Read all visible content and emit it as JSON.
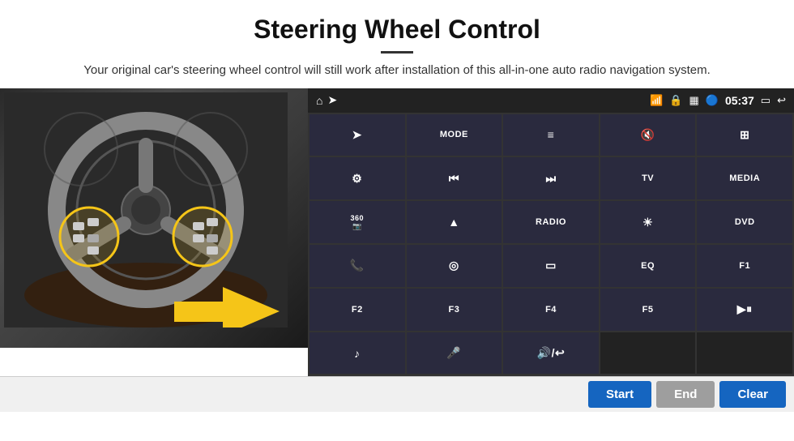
{
  "header": {
    "title": "Steering Wheel Control",
    "subtitle": "Your original car's steering wheel control will still work after installation of this all-in-one auto radio navigation system."
  },
  "status_bar": {
    "home_icon": "⌂",
    "wifi_icon": "📶",
    "lock_icon": "🔒",
    "bt_icon": "🔵",
    "time": "05:37",
    "screen_icon": "▭",
    "back_icon": "↩"
  },
  "button_grid": [
    {
      "label": "✈",
      "type": "icon"
    },
    {
      "label": "MODE",
      "type": "text"
    },
    {
      "label": "≡",
      "type": "icon"
    },
    {
      "label": "🔇",
      "type": "icon"
    },
    {
      "label": "⊞",
      "type": "icon"
    },
    {
      "label": "⚙",
      "type": "icon"
    },
    {
      "label": "⏮",
      "type": "icon"
    },
    {
      "label": "⏭",
      "type": "icon"
    },
    {
      "label": "TV",
      "type": "text"
    },
    {
      "label": "MEDIA",
      "type": "text"
    },
    {
      "label": "360",
      "type": "text"
    },
    {
      "label": "▲",
      "type": "icon"
    },
    {
      "label": "RADIO",
      "type": "text"
    },
    {
      "label": "☀",
      "type": "icon"
    },
    {
      "label": "DVD",
      "type": "text"
    },
    {
      "label": "📞",
      "type": "icon"
    },
    {
      "label": "◎",
      "type": "icon"
    },
    {
      "label": "▭",
      "type": "icon"
    },
    {
      "label": "EQ",
      "type": "text"
    },
    {
      "label": "F1",
      "type": "text"
    },
    {
      "label": "F2",
      "type": "text"
    },
    {
      "label": "F3",
      "type": "text"
    },
    {
      "label": "F4",
      "type": "text"
    },
    {
      "label": "F5",
      "type": "text"
    },
    {
      "label": "▶⏸",
      "type": "icon"
    },
    {
      "label": "♪",
      "type": "icon"
    },
    {
      "label": "🎤",
      "type": "icon"
    },
    {
      "label": "🔊",
      "type": "icon"
    },
    {
      "label": "",
      "type": "empty"
    },
    {
      "label": "",
      "type": "empty"
    }
  ],
  "bottom_bar": {
    "start_label": "Start",
    "end_label": "End",
    "clear_label": "Clear"
  }
}
